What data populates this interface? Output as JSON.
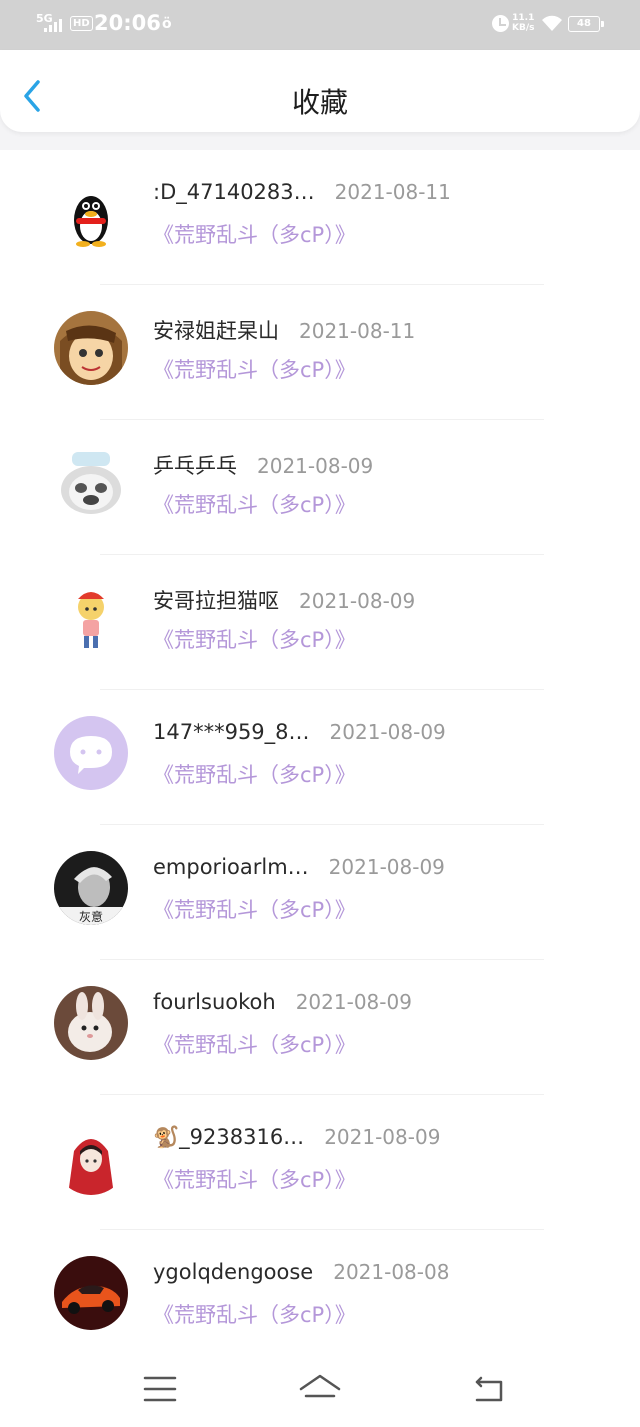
{
  "status_bar": {
    "network": "5G",
    "hd": "HD",
    "time": "20:06",
    "app_icon": "ӧ",
    "speed_value": "11.1",
    "speed_unit": "KB/s",
    "battery": "48"
  },
  "header": {
    "title": "收藏",
    "back_icon": "chevron-left-icon",
    "accent": "#2aa4e6"
  },
  "favorites": [
    {
      "nickname": ":D_47140283…",
      "date": "2021-08-11",
      "subtitle": "《荒野乱斗（多cP）》",
      "avatar": "penguin"
    },
    {
      "nickname": "安禄姐赶杲山",
      "date": "2021-08-11",
      "subtitle": "《荒野乱斗（多cP）》",
      "avatar": "anime"
    },
    {
      "nickname": "乒乓乒乓",
      "date": "2021-08-09",
      "subtitle": "《荒野乱斗（多cP）》",
      "avatar": "panda"
    },
    {
      "nickname": "安哥拉担猫呕",
      "date": "2021-08-09",
      "subtitle": "《荒野乱斗（多cP）》",
      "avatar": "cartoon"
    },
    {
      "nickname": "147***959_8…",
      "date": "2021-08-09",
      "subtitle": "《荒野乱斗（多cP）》",
      "avatar": "default"
    },
    {
      "nickname": "emporioarlm…",
      "date": "2021-08-09",
      "subtitle": "《荒野乱斗（多cP）》",
      "avatar": "bw"
    },
    {
      "nickname": "fourlsuokoh",
      "date": "2021-08-09",
      "subtitle": "《荒野乱斗（多cP）》",
      "avatar": "bunny"
    },
    {
      "nickname": "🐒_9238316…",
      "date": "2021-08-09",
      "subtitle": "《荒野乱斗（多cP）》",
      "avatar": "redhood"
    },
    {
      "nickname": "ygolqdengoose",
      "date": "2021-08-08",
      "subtitle": "《荒野乱斗（多cP）》",
      "avatar": "car"
    }
  ],
  "colors": {
    "subtitle": "#b497d9",
    "date": "#9a9a9a",
    "status_bar": "#d2d2d2"
  },
  "bottom_nav": {
    "menu_icon": "menu-icon",
    "home_icon": "home-icon",
    "back_icon": "return-icon"
  }
}
